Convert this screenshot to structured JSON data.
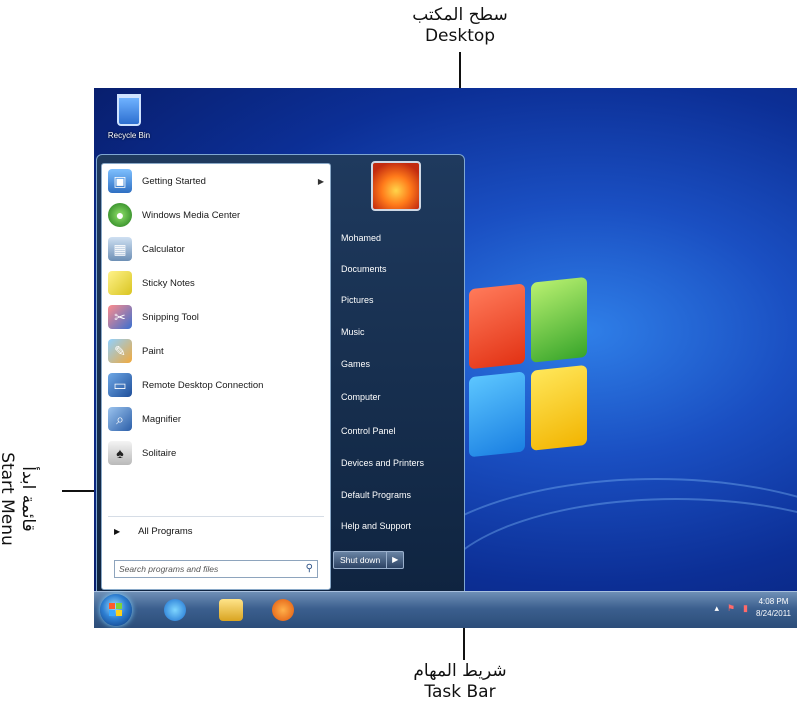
{
  "annotations": {
    "desktop_ar": "سطح المكتب",
    "desktop_en": "Desktop",
    "start_ar": "قائمة ابدأ",
    "start_en": "Start Menu",
    "taskbar_ar": "شريط المهام",
    "taskbar_en": "Task Bar"
  },
  "desktop": {
    "recycle_bin_label": "Recycle Bin"
  },
  "start_menu": {
    "programs": [
      {
        "label": "Getting Started",
        "icon": "getting-started-icon",
        "has_submenu": true
      },
      {
        "label": "Windows Media Center",
        "icon": "media-center-icon"
      },
      {
        "label": "Calculator",
        "icon": "calculator-icon"
      },
      {
        "label": "Sticky Notes",
        "icon": "sticky-notes-icon"
      },
      {
        "label": "Snipping Tool",
        "icon": "snipping-tool-icon"
      },
      {
        "label": "Paint",
        "icon": "paint-icon"
      },
      {
        "label": "Remote Desktop Connection",
        "icon": "remote-desktop-icon"
      },
      {
        "label": "Magnifier",
        "icon": "magnifier-icon"
      },
      {
        "label": "Solitaire",
        "icon": "solitaire-icon"
      }
    ],
    "all_programs_label": "All Programs",
    "search_placeholder": "Search programs and files",
    "right_links": [
      "Mohamed",
      "Documents",
      "Pictures",
      "Music",
      "Games",
      "Computer",
      "Control Panel",
      "Devices and Printers",
      "Default Programs",
      "Help and Support"
    ],
    "shutdown_label": "Shut down"
  },
  "taskbar": {
    "time": "4:08 PM",
    "date": "8/24/2011"
  }
}
